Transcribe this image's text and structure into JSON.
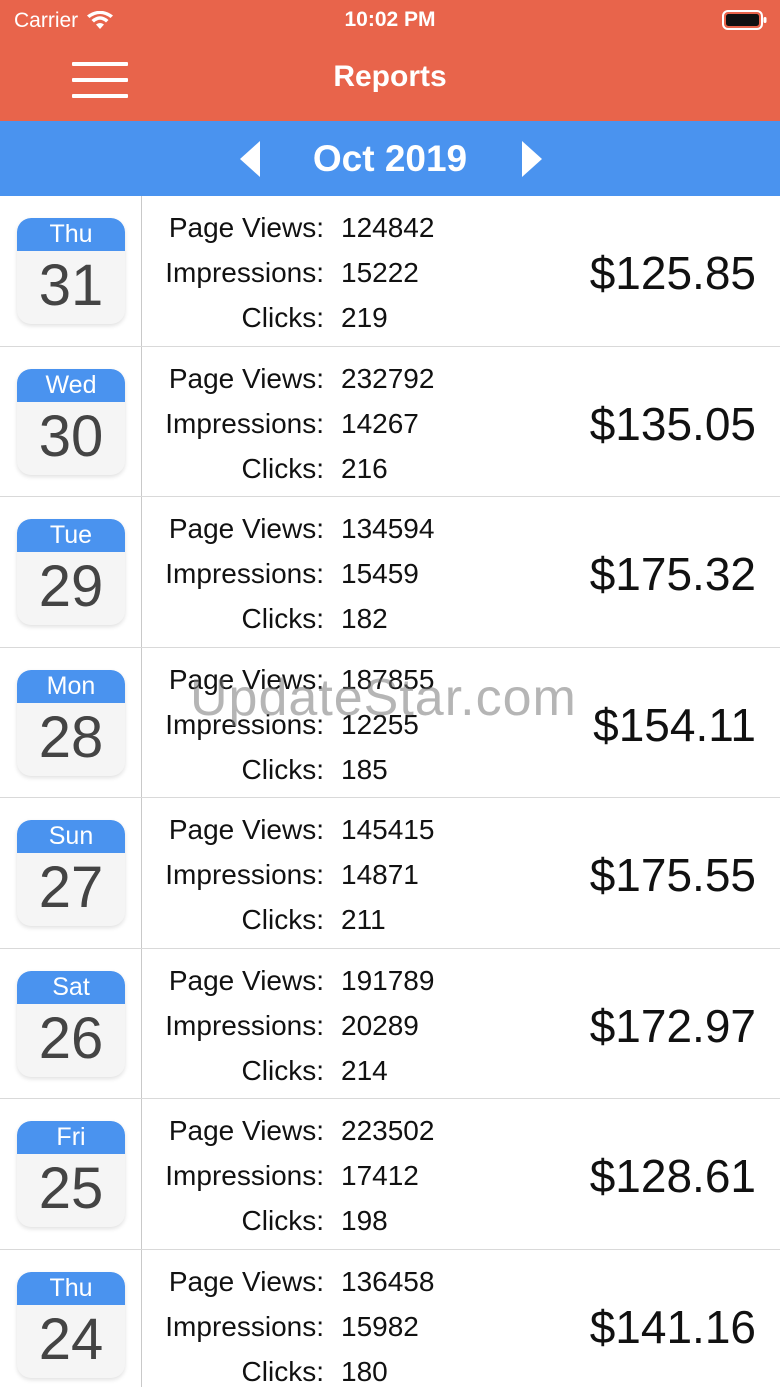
{
  "status_bar": {
    "carrier": "Carrier",
    "time": "10:02 PM",
    "wifi_icon": "wifi-icon",
    "battery_icon": "battery-icon"
  },
  "nav": {
    "title": "Reports",
    "menu_icon": "hamburger-menu-icon"
  },
  "month_bar": {
    "label": "Oct 2019",
    "prev_icon": "chevron-left-icon",
    "next_icon": "chevron-right-icon"
  },
  "labels": {
    "page_views": "Page Views:",
    "impressions": "Impressions:",
    "clicks": "Clicks:"
  },
  "rows": [
    {
      "weekday": "Thu",
      "day": "31",
      "page_views": "124842",
      "impressions": "15222",
      "clicks": "219",
      "amount": "$125.85"
    },
    {
      "weekday": "Wed",
      "day": "30",
      "page_views": "232792",
      "impressions": "14267",
      "clicks": "216",
      "amount": "$135.05"
    },
    {
      "weekday": "Tue",
      "day": "29",
      "page_views": "134594",
      "impressions": "15459",
      "clicks": "182",
      "amount": "$175.32"
    },
    {
      "weekday": "Mon",
      "day": "28",
      "page_views": "187855",
      "impressions": "12255",
      "clicks": "185",
      "amount": "$154.11"
    },
    {
      "weekday": "Sun",
      "day": "27",
      "page_views": "145415",
      "impressions": "14871",
      "clicks": "211",
      "amount": "$175.55"
    },
    {
      "weekday": "Sat",
      "day": "26",
      "page_views": "191789",
      "impressions": "20289",
      "clicks": "214",
      "amount": "$172.97"
    },
    {
      "weekday": "Fri",
      "day": "25",
      "page_views": "223502",
      "impressions": "17412",
      "clicks": "198",
      "amount": "$128.61"
    },
    {
      "weekday": "Thu",
      "day": "24",
      "page_views": "136458",
      "impressions": "15982",
      "clicks": "180",
      "amount": "$141.16"
    }
  ],
  "watermark": "UpdateStar.com",
  "colors": {
    "header": "#e8644b",
    "month_bar": "#4a93ef",
    "calendar_accent": "#4a93ef"
  }
}
